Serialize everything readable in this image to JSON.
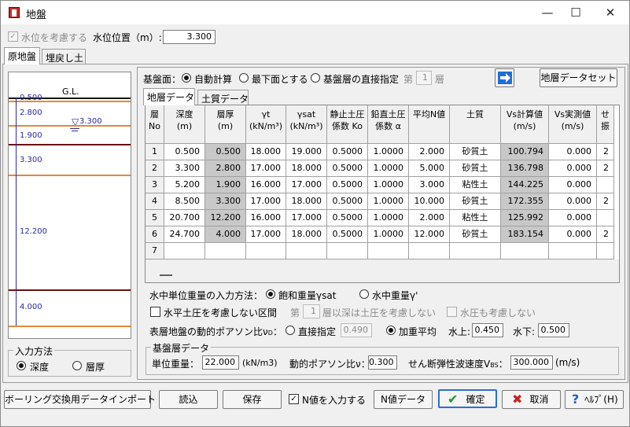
{
  "window": {
    "title": "地盤",
    "minimize": "—",
    "maximize": "☐",
    "close": "✕"
  },
  "top": {
    "water_check_label": "水位を考慮する",
    "water_pos_label": "水位位置（m）:",
    "water_pos_value": "3.300"
  },
  "main_tabs": [
    "原地盤",
    "埋戻し土"
  ],
  "left_diagram": {
    "gl": "G.L.",
    "water_label": "3.300",
    "thickness_labels": [
      "0.500",
      "2.800",
      "1.900",
      "3.300",
      "12.200",
      "4.000"
    ]
  },
  "input_method": {
    "title": "入力方法",
    "options": [
      "深度",
      "層厚"
    ]
  },
  "base_surface": {
    "label": "基盤面：",
    "options": [
      "自動計算",
      "最下面とする",
      "基盤層の直接指定"
    ],
    "layer_prefix": "第",
    "layer_value": "1",
    "layer_suffix": "層"
  },
  "layer_set_button": "地層データセット",
  "sub_tabs": [
    "地層データ",
    "土質データ"
  ],
  "table": {
    "headers": [
      [
        "層",
        "No"
      ],
      [
        "深度",
        "(m)"
      ],
      [
        "層厚",
        "(m)"
      ],
      [
        "γt",
        "(kN/m³)"
      ],
      [
        "γsat",
        "(kN/m³)"
      ],
      [
        "静止土圧",
        "係数 Ko"
      ],
      [
        "鉛直土圧",
        "係数 α"
      ],
      [
        "平均N値",
        ""
      ],
      [
        "土質",
        ""
      ],
      [
        "Vs計算値",
        "(m/s)"
      ],
      [
        "Vs実測値",
        "(m/s)"
      ],
      [
        "せ",
        "振"
      ]
    ],
    "rows": [
      {
        "no": "1",
        "depth": "0.500",
        "thick": "0.500",
        "gt": "18.000",
        "gsat": "19.000",
        "ko": "0.5000",
        "alpha": "1.0000",
        "n": "2.000",
        "soil": "砂質土",
        "vs_calc": "100.794",
        "vs_meas": "0.000",
        "extra": "2"
      },
      {
        "no": "2",
        "depth": "3.300",
        "thick": "2.800",
        "gt": "17.000",
        "gsat": "18.000",
        "ko": "0.5000",
        "alpha": "1.0000",
        "n": "5.000",
        "soil": "砂質土",
        "vs_calc": "136.798",
        "vs_meas": "0.000",
        "extra": "2"
      },
      {
        "no": "3",
        "depth": "5.200",
        "thick": "1.900",
        "gt": "16.000",
        "gsat": "17.000",
        "ko": "0.5000",
        "alpha": "1.0000",
        "n": "3.000",
        "soil": "粘性土",
        "vs_calc": "144.225",
        "vs_meas": "0.000",
        "extra": ""
      },
      {
        "no": "4",
        "depth": "8.500",
        "thick": "3.300",
        "gt": "17.000",
        "gsat": "18.000",
        "ko": "0.5000",
        "alpha": "1.0000",
        "n": "10.000",
        "soil": "砂質土",
        "vs_calc": "172.355",
        "vs_meas": "0.000",
        "extra": "2"
      },
      {
        "no": "5",
        "depth": "20.700",
        "thick": "12.200",
        "gt": "16.000",
        "gsat": "17.000",
        "ko": "0.5000",
        "alpha": "1.0000",
        "n": "2.000",
        "soil": "粘性土",
        "vs_calc": "125.992",
        "vs_meas": "0.000",
        "extra": ""
      },
      {
        "no": "6",
        "depth": "24.700",
        "thick": "4.000",
        "gt": "17.000",
        "gsat": "18.000",
        "ko": "0.5000",
        "alpha": "1.0000",
        "n": "12.000",
        "soil": "砂質土",
        "vs_calc": "183.154",
        "vs_meas": "0.000",
        "extra": "2"
      },
      {
        "no": "7",
        "depth": "",
        "thick": "",
        "gt": "",
        "gsat": "",
        "ko": "",
        "alpha": "",
        "n": "",
        "soil": "",
        "vs_calc": "",
        "vs_meas": "",
        "extra": ""
      }
    ]
  },
  "water_unit": {
    "label": "水中単位重量の入力方法：",
    "options": [
      "飽和重量γsat",
      "水中重量γ'"
    ]
  },
  "horizontal": {
    "label": "水平土圧を考慮しない区間",
    "prefix": "第",
    "value": "1",
    "suffix": "層以深は土圧を考慮しない",
    "water_label": "水圧も考慮しない"
  },
  "poisson": {
    "label": "表層地盤の動的ポアソン比ν",
    "sub": "D",
    "colon": "：",
    "direct": "直接指定",
    "direct_value": "0.490",
    "weighted": "加重平均",
    "above_label": "水上:",
    "above_value": "0.450",
    "below_label": "水下:",
    "below_value": "0.500"
  },
  "base_layer": {
    "title": "基盤層データ",
    "unit_weight_label": "単位重量：",
    "unit_weight_value": "22.000",
    "unit_weight_unit": "(kN/m3)",
    "poisson_label": "動的ポアソン比ν：",
    "poisson_value": "0.300",
    "vs_label": "せん断弾性波速度V",
    "vs_sub": "BS",
    "vs_colon": "：",
    "vs_value": "300.000",
    "vs_unit": "(m/s)"
  },
  "bottom": {
    "import": "ボーリング交換用データインポート",
    "load": "読込",
    "save": "保存",
    "n_check": "N値を入力する",
    "n_data": "N値データ",
    "ok": "確定",
    "cancel": "取消",
    "help": "ﾍﾙﾌﾟ(H)"
  }
}
